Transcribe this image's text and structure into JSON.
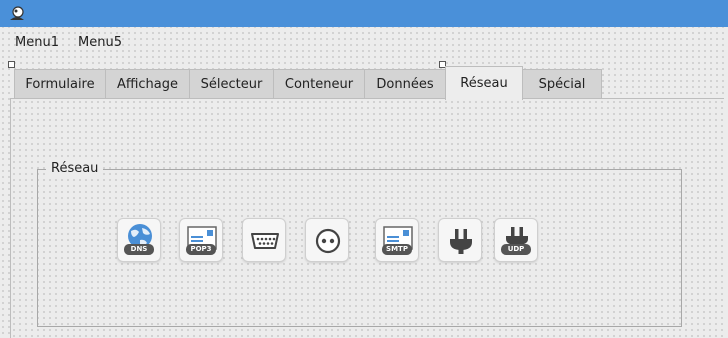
{
  "window": {
    "app_icon": "app-logo-icon"
  },
  "menubar": {
    "items": [
      {
        "label": "Menu1"
      },
      {
        "label": "Menu5"
      }
    ]
  },
  "tabs": [
    {
      "label": "Formulaire",
      "active": false
    },
    {
      "label": "Affichage",
      "active": false
    },
    {
      "label": "Sélecteur",
      "active": false
    },
    {
      "label": "Conteneur",
      "active": false
    },
    {
      "label": "Données",
      "active": false
    },
    {
      "label": "Réseau",
      "active": true
    },
    {
      "label": "Spécial",
      "active": false
    }
  ],
  "group": {
    "title": "Réseau",
    "buttons": [
      {
        "icon": "dns-globe-icon",
        "badge": "DNS"
      },
      {
        "icon": "pop3-mail-icon",
        "badge": "POP3"
      },
      {
        "icon": "serial-port-icon",
        "badge": ""
      },
      {
        "icon": "socket-icon",
        "badge": ""
      },
      {
        "icon": "smtp-mail-icon",
        "badge": "SMTP"
      },
      {
        "icon": "power-plug-icon",
        "badge": ""
      },
      {
        "icon": "udp-plug-icon",
        "badge": "UDP"
      }
    ]
  },
  "colors": {
    "titlebar": "#4a90d9",
    "icon_dark": "#555555",
    "icon_blue": "#4a8fd6"
  }
}
